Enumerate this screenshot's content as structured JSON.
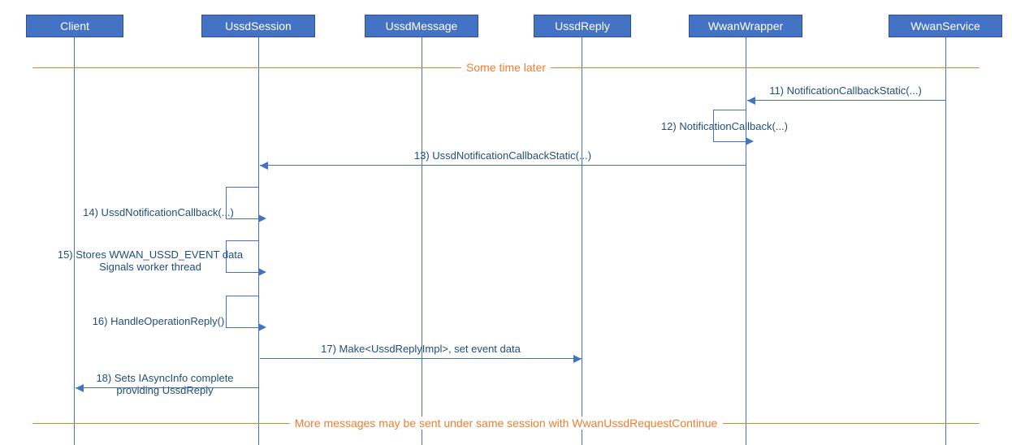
{
  "participants": {
    "client": "Client",
    "ussdSession": "UssdSession",
    "ussdMessage": "UssdMessage",
    "ussdReply": "UssdReply",
    "wwanWrapper": "WwanWrapper",
    "wwanService": "WwanService"
  },
  "dividers": {
    "top": "Some time later",
    "bottom": "More messages may be sent under same session with WwanUssdRequestContinue"
  },
  "messages": {
    "m11": "11) NotificationCallbackStatic(...)",
    "m12": "12) NotificationCallback(...)",
    "m13": "13) UssdNotificationCallbackStatic(...)",
    "m14": "14) UssdNotificationCallback(...)",
    "m15_line1": "15) Stores WWAN_USSD_EVENT data",
    "m15_line2": "Signals worker thread",
    "m16": "16) HandleOperationReply()",
    "m17": "17) Make<UssdReplyImpl>, set event data",
    "m18_line1": "18) Sets IAsyncInfo complete",
    "m18_line2": "providing UssdReply"
  },
  "chart_data": {
    "type": "sequence",
    "participants": [
      "Client",
      "UssdSession",
      "UssdMessage",
      "UssdReply",
      "WwanWrapper",
      "WwanService"
    ],
    "dividers": [
      {
        "text": "Some time later"
      },
      {
        "text": "More messages may be sent under same session with WwanUssdRequestContinue"
      }
    ],
    "messages": [
      {
        "n": 11,
        "from": "WwanService",
        "to": "WwanWrapper",
        "label": "NotificationCallbackStatic(...)"
      },
      {
        "n": 12,
        "from": "WwanWrapper",
        "to": "WwanWrapper",
        "label": "NotificationCallback(...)",
        "self": true
      },
      {
        "n": 13,
        "from": "WwanWrapper",
        "to": "UssdSession",
        "label": "UssdNotificationCallbackStatic(...)"
      },
      {
        "n": 14,
        "from": "UssdSession",
        "to": "UssdSession",
        "label": "UssdNotificationCallback(...)",
        "self": true
      },
      {
        "n": 15,
        "from": "UssdSession",
        "to": "UssdSession",
        "label": "Stores WWAN_USSD_EVENT data / Signals worker thread",
        "self": true
      },
      {
        "n": 16,
        "from": "UssdSession",
        "to": "UssdSession",
        "label": "HandleOperationReply()",
        "self": true
      },
      {
        "n": 17,
        "from": "UssdSession",
        "to": "UssdReply",
        "label": "Make<UssdReplyImpl>, set event data"
      },
      {
        "n": 18,
        "from": "UssdSession",
        "to": "Client",
        "label": "Sets IAsyncInfo complete providing UssdReply"
      }
    ]
  }
}
